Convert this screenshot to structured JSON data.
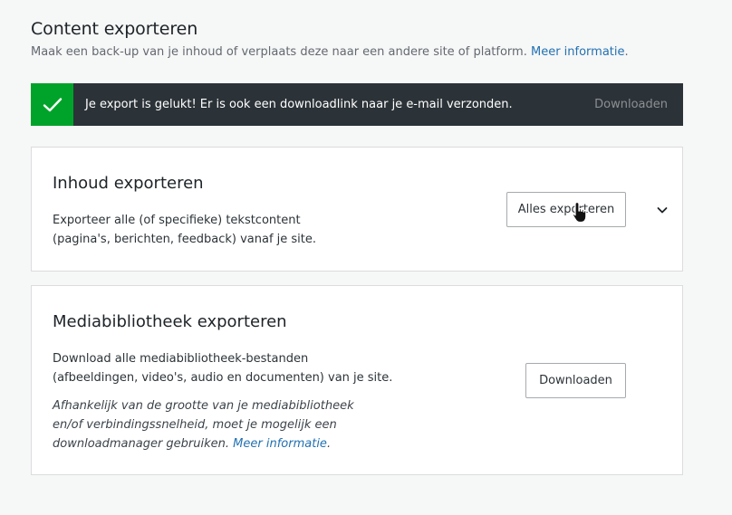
{
  "header": {
    "title": "Content exporteren",
    "subtitle": "Maak een back-up van je inhoud of verplaats deze naar een andere site of platform.",
    "more_info_link": "Meer informatie"
  },
  "notice": {
    "status": "success",
    "icon": "checkmark-icon",
    "message": "Je export is gelukt! Er is ook een downloadlink naar je e-mail verzonden.",
    "action_label": "Downloaden",
    "colors": {
      "background": "#2c3338",
      "icon_bg": "#00a32a"
    }
  },
  "export_content": {
    "title": "Inhoud exporteren",
    "description_line1": "Exporteer alle (of specifieke) tekstcontent",
    "description_line2": "(pagina's, berichten, feedback) vanaf je site.",
    "button_label": "Alles exporteren",
    "toggle_icon": "chevron-down-icon"
  },
  "export_media": {
    "title": "Mediabibliotheek exporteren",
    "description_line1": "Download alle mediabibliotheek-bestanden",
    "description_line2": "(afbeeldingen, video's, audio en documenten) van je site.",
    "note_line1": "Afhankelijk van de grootte van je mediabibliotheek",
    "note_line2": "en/of verbindingssnelheid, moet je mogelijk een",
    "note_line3": "downloadmanager gebruiken.",
    "note_link": "Meer informatie",
    "note_period": ".",
    "button_label": "Downloaden"
  },
  "accent_color": "#2271b1"
}
